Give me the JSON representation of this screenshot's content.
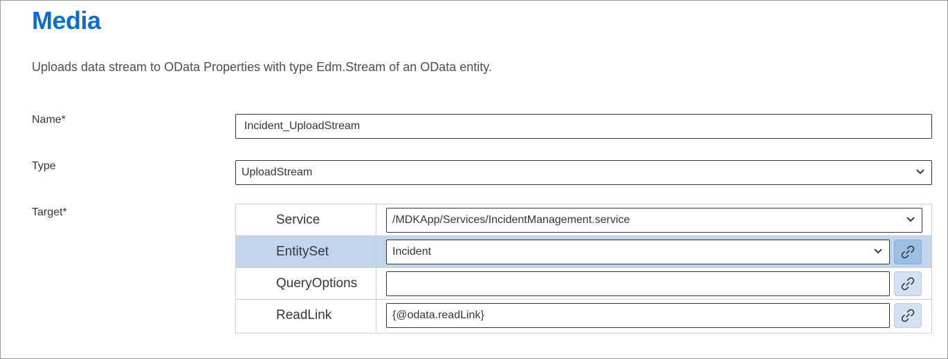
{
  "header": {
    "title": "Media",
    "description": "Uploads data stream to OData Properties with type Edm.Stream of an OData entity."
  },
  "form": {
    "name": {
      "label": "Name*",
      "value": "Incident_UploadStream"
    },
    "type": {
      "label": "Type",
      "value": "UploadStream"
    },
    "target": {
      "label": "Target*"
    }
  },
  "target": {
    "rows": [
      {
        "label": "Service",
        "value": "/MDKApp/Services/IncidentManagement.service",
        "control": "select",
        "selected": false
      },
      {
        "label": "EntitySet",
        "value": "Incident",
        "control": "select",
        "selected": true
      },
      {
        "label": "QueryOptions",
        "value": "",
        "control": "input",
        "selected": false
      },
      {
        "label": "ReadLink",
        "value": "{@odata.readLink}",
        "control": "input",
        "selected": false
      }
    ]
  },
  "icons": {
    "dropdown": "chevron-down-icon",
    "binding": "link-icon"
  },
  "colors": {
    "accent": "#0a6ed1",
    "selected_row": "#c1d5ed",
    "link_button": "#d4e1f2"
  }
}
